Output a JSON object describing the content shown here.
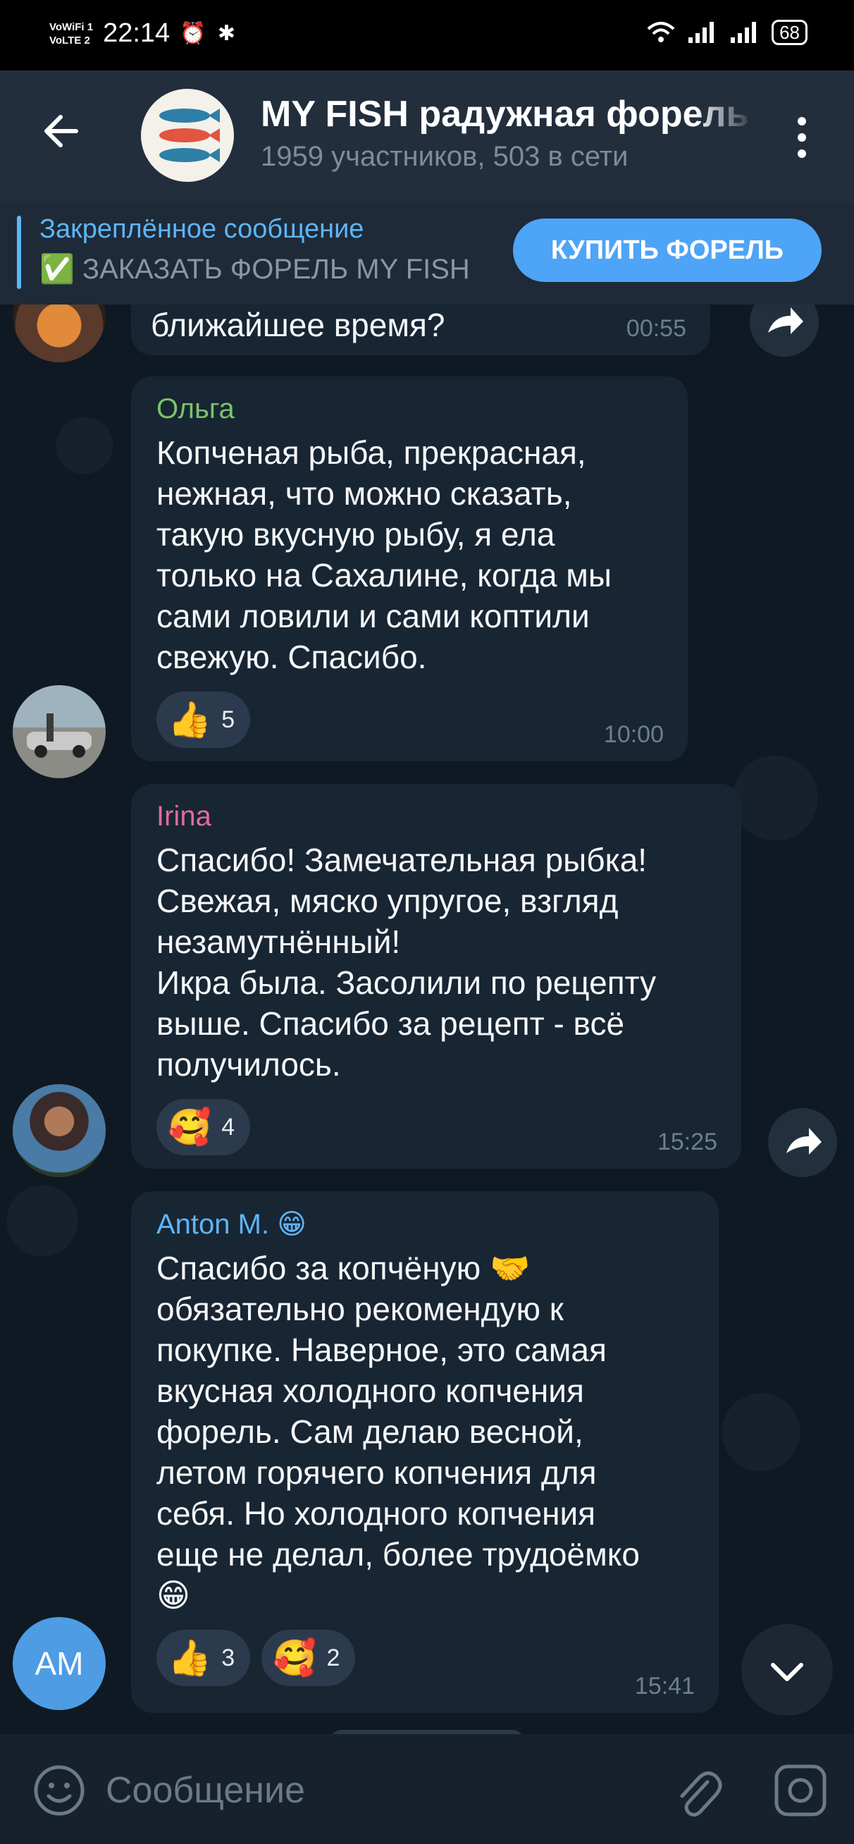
{
  "status_bar": {
    "network_line1": "VoWiFi 1",
    "network_line2": "VoLTE 2",
    "time": "22:14",
    "icons": "⏰ ✱",
    "battery": "68"
  },
  "header": {
    "title": "MY FISH радужная форель",
    "subtitle": "1959 участников, 503 в сети"
  },
  "pinned": {
    "label": "Закреплённое сообщение",
    "text": "✅ ЗАКАЗАТЬ ФОРЕЛЬ MY FISH",
    "button": "КУПИТЬ ФОРЕЛЬ"
  },
  "messages": [
    {
      "author": "",
      "text": "ближайшее время?",
      "time": "00:55"
    },
    {
      "author": "Ольга",
      "author_color": "#7ac36a",
      "text": "Копченая рыба, прекрасная,\nнежная, что можно сказать,\nтакую вкусную рыбу, я ела\nтолько на Сахалине, когда мы\nсами ловили и сами коптили\nсвежую. Спасибо.",
      "reactions": [
        {
          "emoji": "👍",
          "count": "5"
        }
      ],
      "time": "10:00"
    },
    {
      "author": "Irina",
      "author_color": "#e06c9b",
      "text": "Спасибо! Замечательная рыбка!\nСвежая, мяско упругое, взгляд\nнезамутнённый!\nИкра была. Засолили по рецепту\nвыше. Спасибо за рецепт - всё\nполучилось.",
      "reactions": [
        {
          "emoji": "🥰",
          "count": "4"
        }
      ],
      "time": "15:25"
    },
    {
      "author": "Anton M. 😁",
      "author_color": "#5eb5f7",
      "text": "Спасибо за копчёную 🤝\nобязательно рекомендую к\nпокупке. Наверное, это самая\nвкусная холодного копчения\nфорель. Сам делаю весной,\nлетом горячего копчения для\nсебя. Но холодного копчения\nеще не делал, более трудоёмко\n😁",
      "reactions": [
        {
          "emoji": "👍",
          "count": "3"
        },
        {
          "emoji": "🥰",
          "count": "2"
        }
      ],
      "time": "15:41"
    }
  ],
  "am_avatar_initials": "AM",
  "input": {
    "placeholder": "Сообщение"
  }
}
